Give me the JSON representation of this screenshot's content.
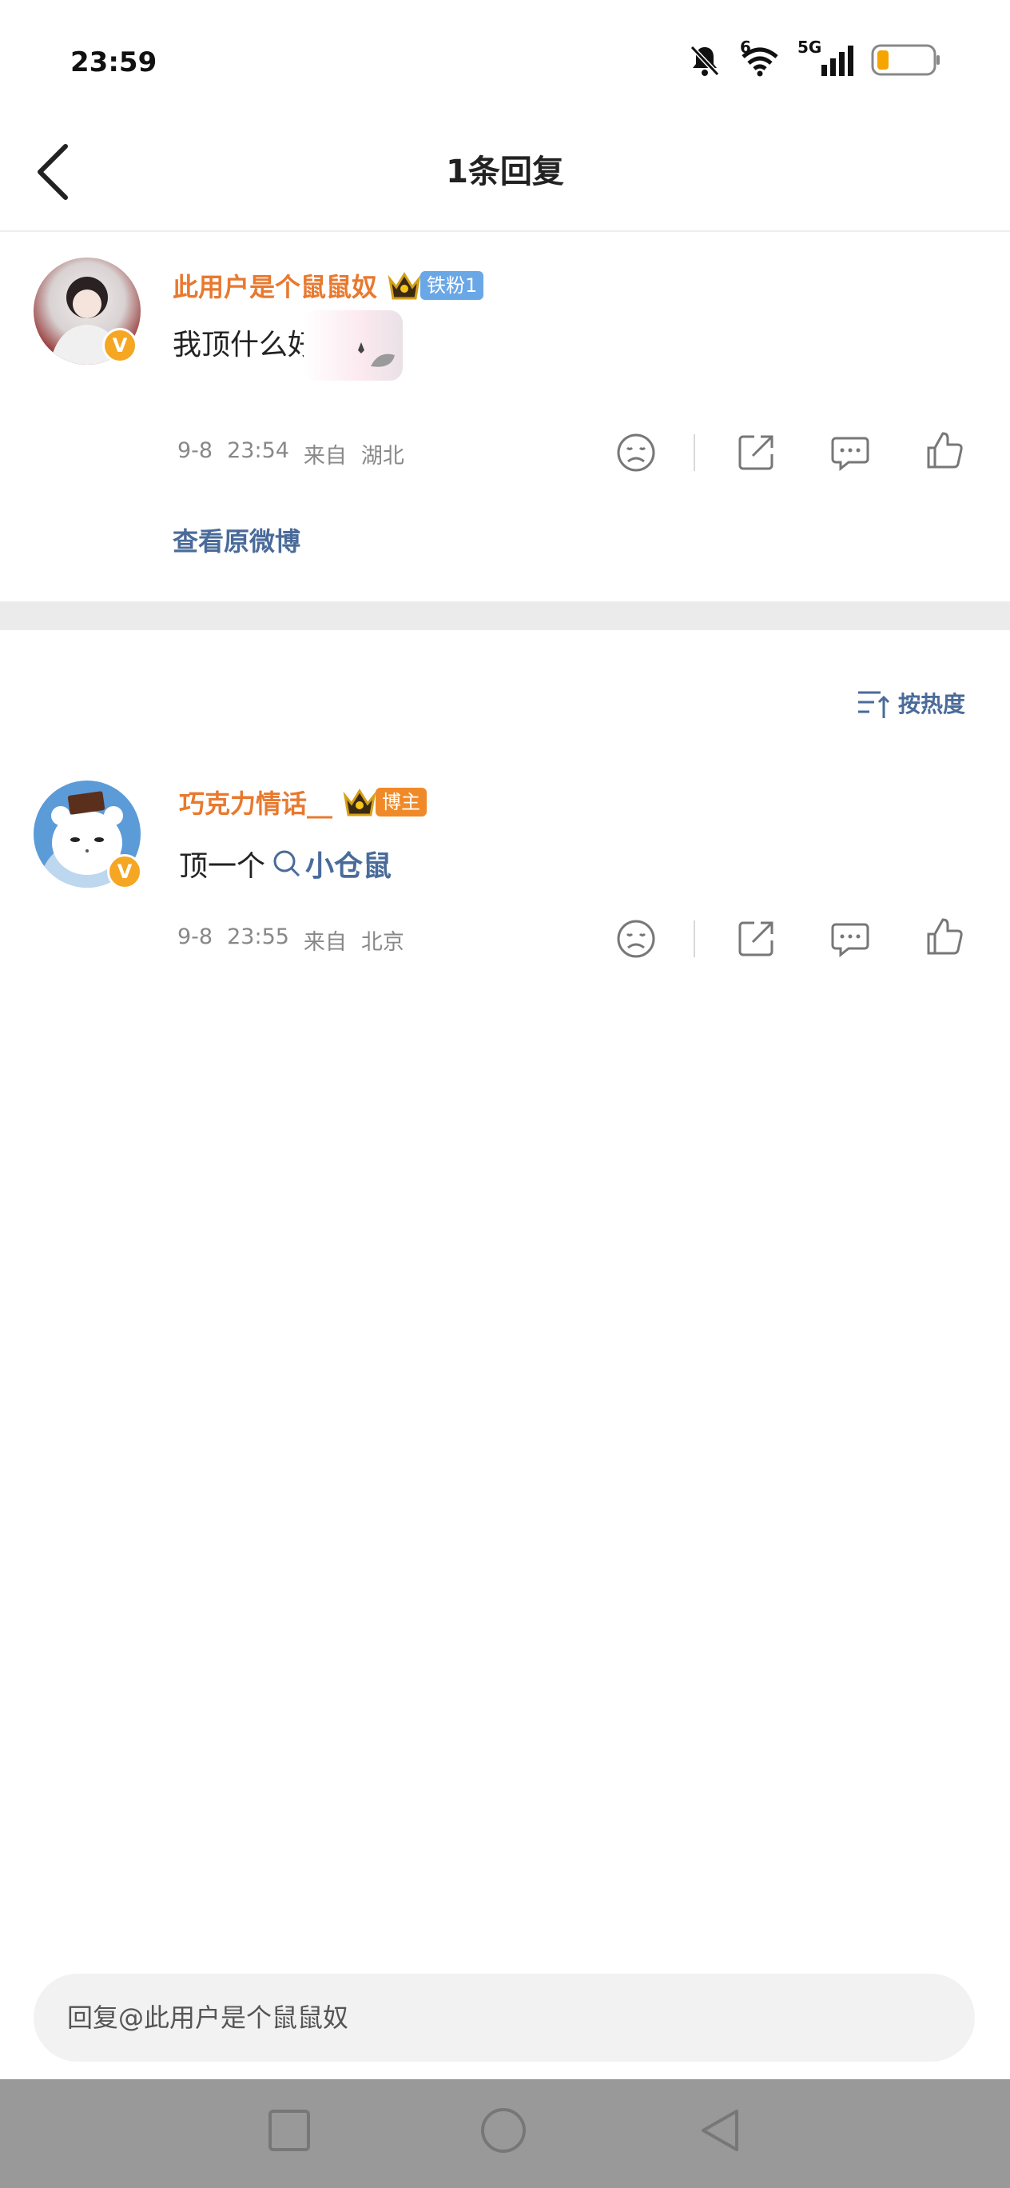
{
  "status_bar": {
    "time": "23:59",
    "wifi_badge": "6",
    "network": "5G"
  },
  "header": {
    "title": "1条回复"
  },
  "original_comment": {
    "username": "此用户是个鼠鼠奴",
    "fan_badge": "铁粉1",
    "verified_mark": "V",
    "content": "我顶什么好",
    "date": "9-8",
    "time": "23:54",
    "source_prefix": "来自",
    "location": "湖北",
    "view_original": "查看原微博"
  },
  "sort": {
    "label": "按热度"
  },
  "reply": {
    "username": "巧克力情话__",
    "role_badge": "博主",
    "verified_mark": "V",
    "content_prefix": "顶一个",
    "search_link": "小仓鼠",
    "date": "9-8",
    "time": "23:55",
    "source_prefix": "来自",
    "location": "北京"
  },
  "reply_input": {
    "placeholder": "回复@此用户是个鼠鼠奴"
  },
  "colors": {
    "username": "#e8792f",
    "link": "#4a6b9a",
    "fan_badge": "#6aa7e6",
    "role_badge": "#f08a28"
  }
}
